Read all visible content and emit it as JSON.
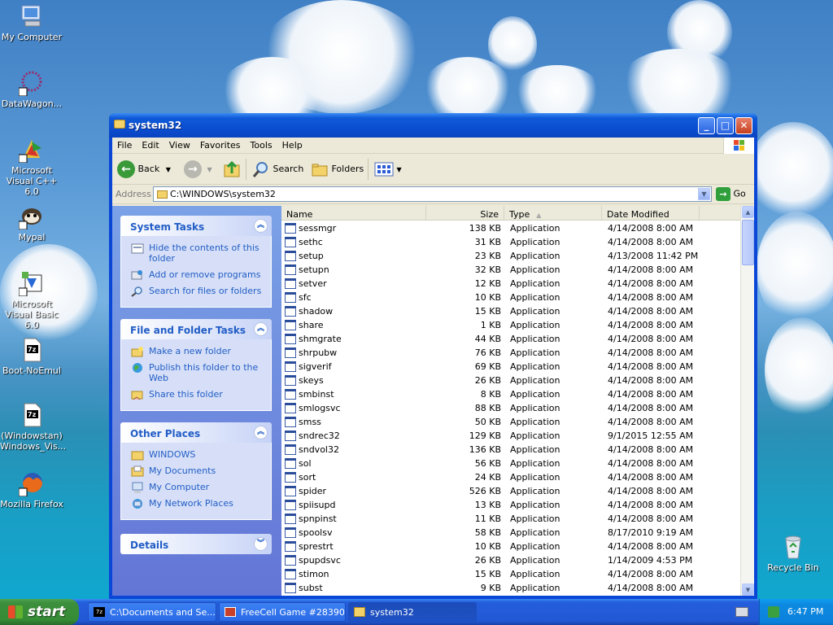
{
  "desktop": {
    "icons": [
      {
        "label": "My Computer",
        "icon": "my-computer-icon"
      },
      {
        "label": "DataWagon...",
        "icon": "datawagon-icon"
      },
      {
        "label": "Microsoft Visual C++ 6.0",
        "icon": "visual-cpp-icon"
      },
      {
        "label": "Mypal",
        "icon": "mypal-icon"
      },
      {
        "label": "Microsoft Visual Basic 6.0",
        "icon": "visual-basic-icon"
      },
      {
        "label": "Boot-NoEmul",
        "icon": "7z-file-icon"
      },
      {
        "label": "(Windowstan) Windows_Vis...",
        "icon": "7z-file-icon"
      },
      {
        "label": "Mozilla Firefox",
        "icon": "firefox-icon"
      }
    ],
    "recycle_bin": "Recycle Bin"
  },
  "window": {
    "title": "system32",
    "menu": [
      "File",
      "Edit",
      "View",
      "Favorites",
      "Tools",
      "Help"
    ],
    "toolbar": {
      "back": "Back",
      "search": "Search",
      "folders": "Folders"
    },
    "address": {
      "label": "Address",
      "value": "C:\\WINDOWS\\system32",
      "go": "Go"
    }
  },
  "taskpane": {
    "system_tasks": {
      "title": "System Tasks",
      "links": [
        "Hide the contents of this folder",
        "Add or remove programs",
        "Search for files or folders"
      ]
    },
    "file_folder_tasks": {
      "title": "File and Folder Tasks",
      "links": [
        "Make a new folder",
        "Publish this folder to the Web",
        "Share this folder"
      ]
    },
    "other_places": {
      "title": "Other Places",
      "links": [
        "WINDOWS",
        "My Documents",
        "My Computer",
        "My Network Places"
      ]
    },
    "details": {
      "title": "Details"
    }
  },
  "columns": {
    "name": "Name",
    "size": "Size",
    "type": "Type",
    "date": "Date Modified"
  },
  "files": [
    {
      "name": "sessmgr",
      "size": "138 KB",
      "type": "Application",
      "date": "4/14/2008 8:00 AM"
    },
    {
      "name": "sethc",
      "size": "31 KB",
      "type": "Application",
      "date": "4/14/2008 8:00 AM"
    },
    {
      "name": "setup",
      "size": "23 KB",
      "type": "Application",
      "date": "4/13/2008 11:42 PM"
    },
    {
      "name": "setupn",
      "size": "32 KB",
      "type": "Application",
      "date": "4/14/2008 8:00 AM"
    },
    {
      "name": "setver",
      "size": "12 KB",
      "type": "Application",
      "date": "4/14/2008 8:00 AM"
    },
    {
      "name": "sfc",
      "size": "10 KB",
      "type": "Application",
      "date": "4/14/2008 8:00 AM"
    },
    {
      "name": "shadow",
      "size": "15 KB",
      "type": "Application",
      "date": "4/14/2008 8:00 AM"
    },
    {
      "name": "share",
      "size": "1 KB",
      "type": "Application",
      "date": "4/14/2008 8:00 AM"
    },
    {
      "name": "shmgrate",
      "size": "44 KB",
      "type": "Application",
      "date": "4/14/2008 8:00 AM"
    },
    {
      "name": "shrpubw",
      "size": "76 KB",
      "type": "Application",
      "date": "4/14/2008 8:00 AM"
    },
    {
      "name": "sigverif",
      "size": "69 KB",
      "type": "Application",
      "date": "4/14/2008 8:00 AM"
    },
    {
      "name": "skeys",
      "size": "26 KB",
      "type": "Application",
      "date": "4/14/2008 8:00 AM"
    },
    {
      "name": "smbinst",
      "size": "8 KB",
      "type": "Application",
      "date": "4/14/2008 8:00 AM"
    },
    {
      "name": "smlogsvc",
      "size": "88 KB",
      "type": "Application",
      "date": "4/14/2008 8:00 AM"
    },
    {
      "name": "smss",
      "size": "50 KB",
      "type": "Application",
      "date": "4/14/2008 8:00 AM"
    },
    {
      "name": "sndrec32",
      "size": "129 KB",
      "type": "Application",
      "date": "9/1/2015 12:55 AM"
    },
    {
      "name": "sndvol32",
      "size": "136 KB",
      "type": "Application",
      "date": "4/14/2008 8:00 AM"
    },
    {
      "name": "sol",
      "size": "56 KB",
      "type": "Application",
      "date": "4/14/2008 8:00 AM"
    },
    {
      "name": "sort",
      "size": "24 KB",
      "type": "Application",
      "date": "4/14/2008 8:00 AM"
    },
    {
      "name": "spider",
      "size": "526 KB",
      "type": "Application",
      "date": "4/14/2008 8:00 AM"
    },
    {
      "name": "spiisupd",
      "size": "13 KB",
      "type": "Application",
      "date": "4/14/2008 8:00 AM"
    },
    {
      "name": "spnpinst",
      "size": "11 KB",
      "type": "Application",
      "date": "4/14/2008 8:00 AM"
    },
    {
      "name": "spoolsv",
      "size": "58 KB",
      "type": "Application",
      "date": "8/17/2010 9:19 AM"
    },
    {
      "name": "sprestrt",
      "size": "10 KB",
      "type": "Application",
      "date": "4/14/2008 8:00 AM"
    },
    {
      "name": "spupdsvc",
      "size": "26 KB",
      "type": "Application",
      "date": "1/14/2009 4:53 PM"
    },
    {
      "name": "stimon",
      "size": "15 KB",
      "type": "Application",
      "date": "4/14/2008 8:00 AM"
    },
    {
      "name": "subst",
      "size": "9 KB",
      "type": "Application",
      "date": "4/14/2008 8:00 AM"
    }
  ],
  "taskbar": {
    "start": "start",
    "items": [
      {
        "label": "C:\\Documents and Se...",
        "icon": "7z-icon"
      },
      {
        "label": "FreeCell Game #28390",
        "icon": "freecell-icon"
      },
      {
        "label": "system32",
        "icon": "folder-icon"
      }
    ],
    "clock": "6:47 PM"
  }
}
